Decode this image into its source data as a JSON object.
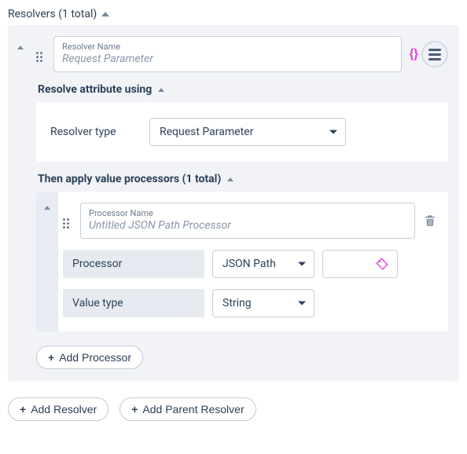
{
  "header": {
    "title": "Resolvers (1 total)"
  },
  "resolver": {
    "name_label": "Resolver Name",
    "name_placeholder": "Request Parameter",
    "resolve_section_title": "Resolve attribute using",
    "type_label": "Resolver type",
    "type_value": "Request Parameter",
    "processors_header": "Then apply value processors (1 total)",
    "processor": {
      "name_label": "Processor Name",
      "name_placeholder": "Untitled JSON Path Processor",
      "processor_field_label": "Processor",
      "processor_value": "JSON Path",
      "valuetype_field_label": "Value type",
      "valuetype_value": "String"
    },
    "add_processor_label": "Add Processor"
  },
  "footer": {
    "add_resolver_label": "Add Resolver",
    "add_parent_resolver_label": "Add Parent Resolver"
  }
}
